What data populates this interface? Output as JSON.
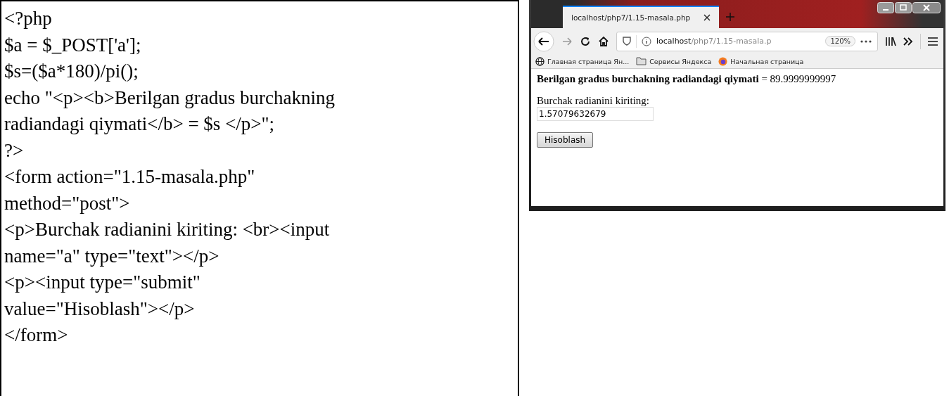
{
  "code_lines": [
    "<?php",
    "$a = $_POST['a'];",
    "$s=($a*180)/pi();",
    "echo \"<p><b>Berilgan gradus burchakning",
    "radiandagi qiymati</b> = $s </p>\";",
    "?>",
    "<form action=\"1.15-masala.php\"",
    "method=\"post\">",
    "<p>Burchak radianini kiriting: <br><input",
    "name=\"a\" type=\"text\"></p>",
    "<p><input type=\"submit\"",
    "value=\"Hisoblash\"></p>",
    "</form>"
  ],
  "browser": {
    "tab": {
      "title": "localhost/php7/1.15-masala.php",
      "selected": true
    },
    "address": {
      "host": "localhost",
      "path": "/php7/1.15-masala.p",
      "zoom": "120%"
    },
    "bookmarks": [
      {
        "label": "Главная страница Ян...",
        "kind": "globe"
      },
      {
        "label": "Сервисы Яндекса",
        "kind": "folder"
      },
      {
        "label": "Начальная страница",
        "kind": "firefox"
      }
    ],
    "page": {
      "result": "**Berilgan gradus burchakning radiandagi qiymati** = 89.9999999997",
      "label": "Burchak radianini kiriting:",
      "value": "1.57079632679",
      "button": "Hisoblash"
    }
  }
}
